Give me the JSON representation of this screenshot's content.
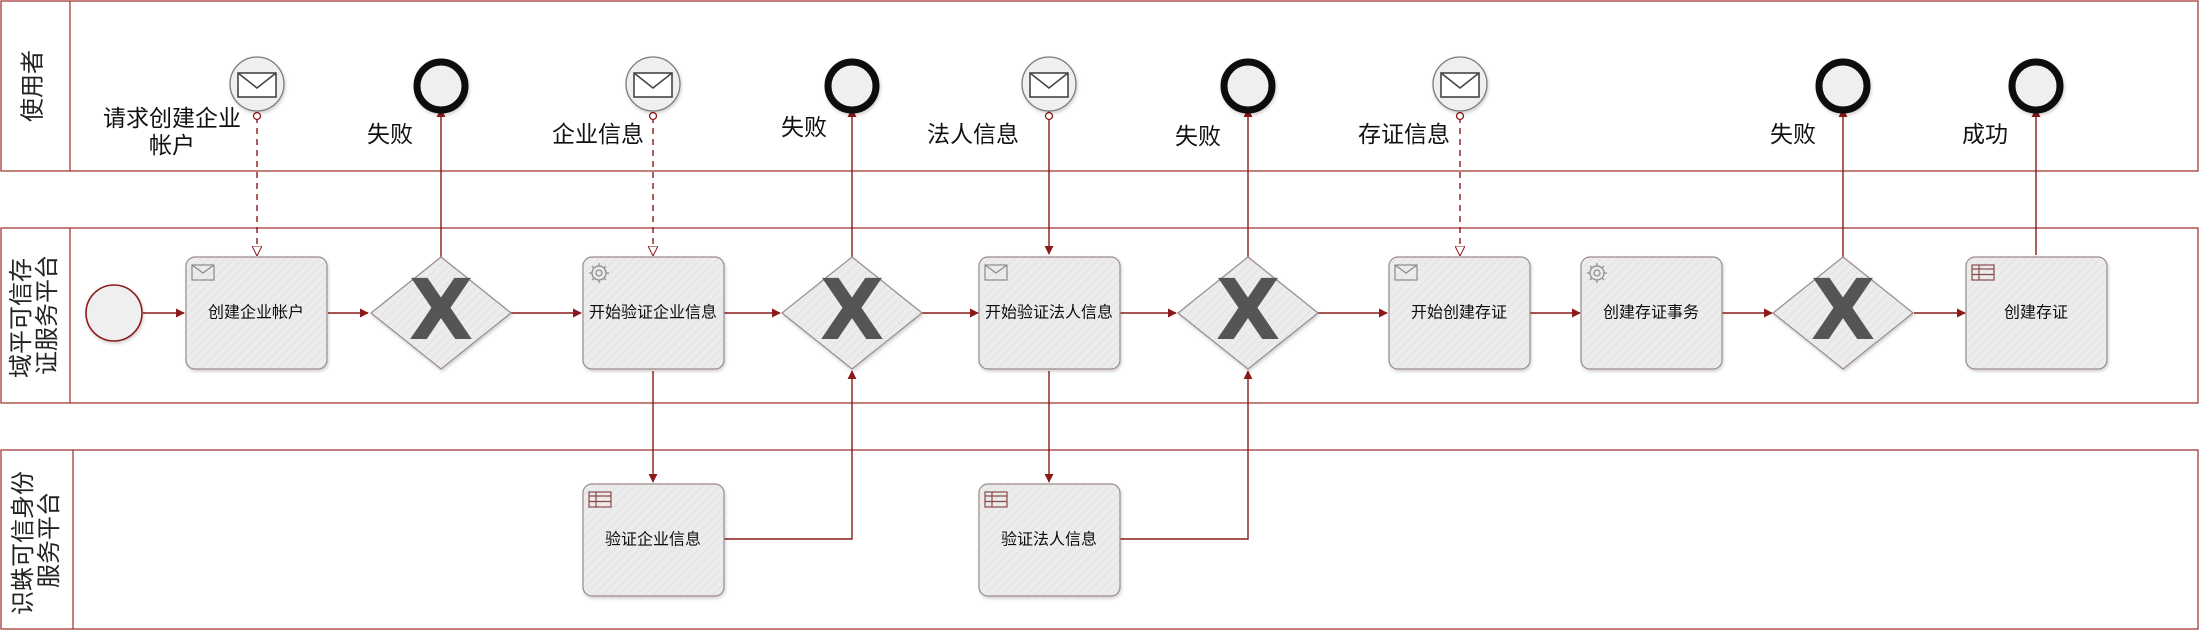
{
  "lanes": {
    "user": "使用者",
    "platform": "域平可信存证服务平台",
    "identity": "识蛛可信身份服务平台"
  },
  "messages": {
    "m1": "请求创建企业帐户",
    "m2": "企业信息",
    "m3": "法人信息",
    "m4": "存证信息"
  },
  "ends": {
    "e1": "失败",
    "e2": "失败",
    "e3": "失败",
    "e4": "失败",
    "e5": "成功"
  },
  "tasks": {
    "t1": "创建企业帐户",
    "t2": "开始验证企业信息",
    "t3": "开始验证法人信息",
    "t4": "开始创建存证",
    "t5": "创建存证事务",
    "t6": "创建存证",
    "t7": "验证企业信息",
    "t8": "验证法人信息"
  },
  "gateway_symbol": "X",
  "colors": {
    "border": "#9c2a2a",
    "task_fill": "#ececec",
    "event_fill": "#efefef",
    "icon_gray": "#7a7a7a"
  }
}
